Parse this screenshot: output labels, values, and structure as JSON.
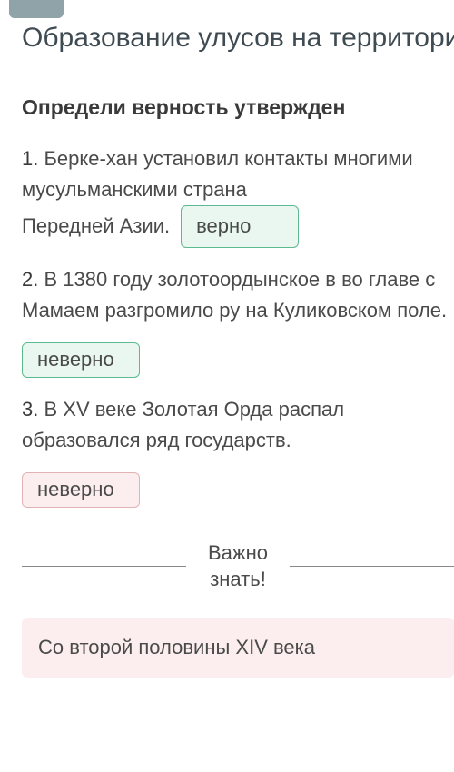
{
  "header": {
    "title": "Образование улусов на территории Казахстана. Ур"
  },
  "task": {
    "prompt": "Определи верность утвержден",
    "statements": [
      {
        "num": "1.",
        "text_start": "Берке-хан установил контакты многими мусульманскими страна",
        "text_tail": "Передней Азии.",
        "answer": "верно",
        "answer_state": "correct"
      },
      {
        "num": "2.",
        "text": "В 1380 году золотоордынское в во главе с Мамаем разгромило ру на Куликовском поле.",
        "answer": "неверно",
        "answer_state": "correct"
      },
      {
        "num": "3.",
        "text": "В XV веке Золотая Орда распал образовался ряд государств.",
        "answer": "неверно",
        "answer_state": "wrong"
      }
    ]
  },
  "divider": {
    "label": "Важно знать!"
  },
  "info": {
    "text": "Со второй половины XIV века"
  },
  "colors": {
    "correct_bg": "#e9f7f0",
    "correct_border": "#5db98f",
    "wrong_bg": "#fceeee",
    "wrong_border": "#e2b3b3"
  }
}
